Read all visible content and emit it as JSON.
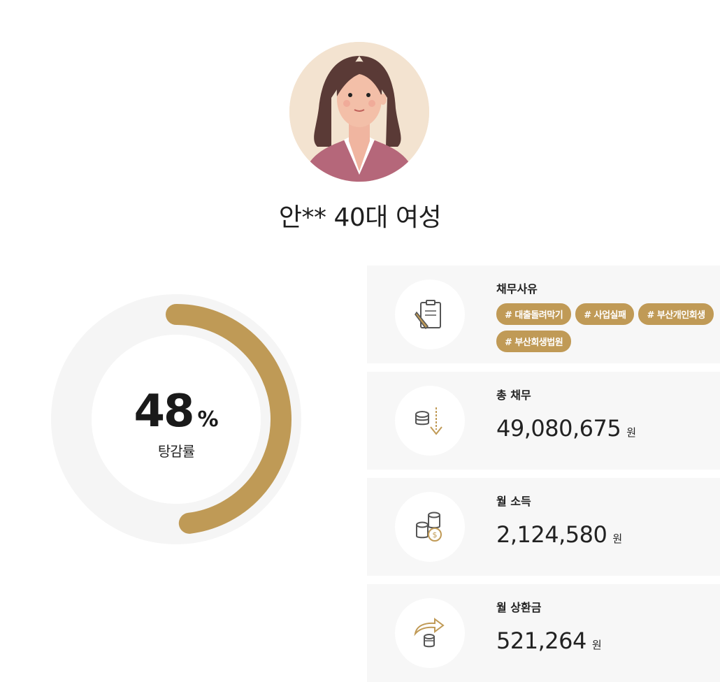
{
  "profile": {
    "name": "안** 40대 여성"
  },
  "gauge": {
    "value": "48",
    "unit": "%",
    "label": "탕감률",
    "percent": 48,
    "color": "#bf9a56"
  },
  "cards": [
    {
      "label": "채무사유",
      "icon": "clipboard-pencil-icon",
      "tags": [
        "# 대출돌려막기",
        "# 사업실패",
        "# 부산개인회생",
        "# 부산회생법원"
      ]
    },
    {
      "label": "총 채무",
      "icon": "coins-down-arrow-icon",
      "amount": "49,080,675",
      "unit": "원"
    },
    {
      "label": "월 소득",
      "icon": "coins-stack-icon",
      "amount": "2,124,580",
      "unit": "원"
    },
    {
      "label": "월 상환금",
      "icon": "coins-repay-arrow-icon",
      "amount": "521,264",
      "unit": "원"
    }
  ],
  "colors": {
    "accent": "#bf9a56",
    "card_bg": "#f7f7f7",
    "track": "#f5f5f5"
  }
}
